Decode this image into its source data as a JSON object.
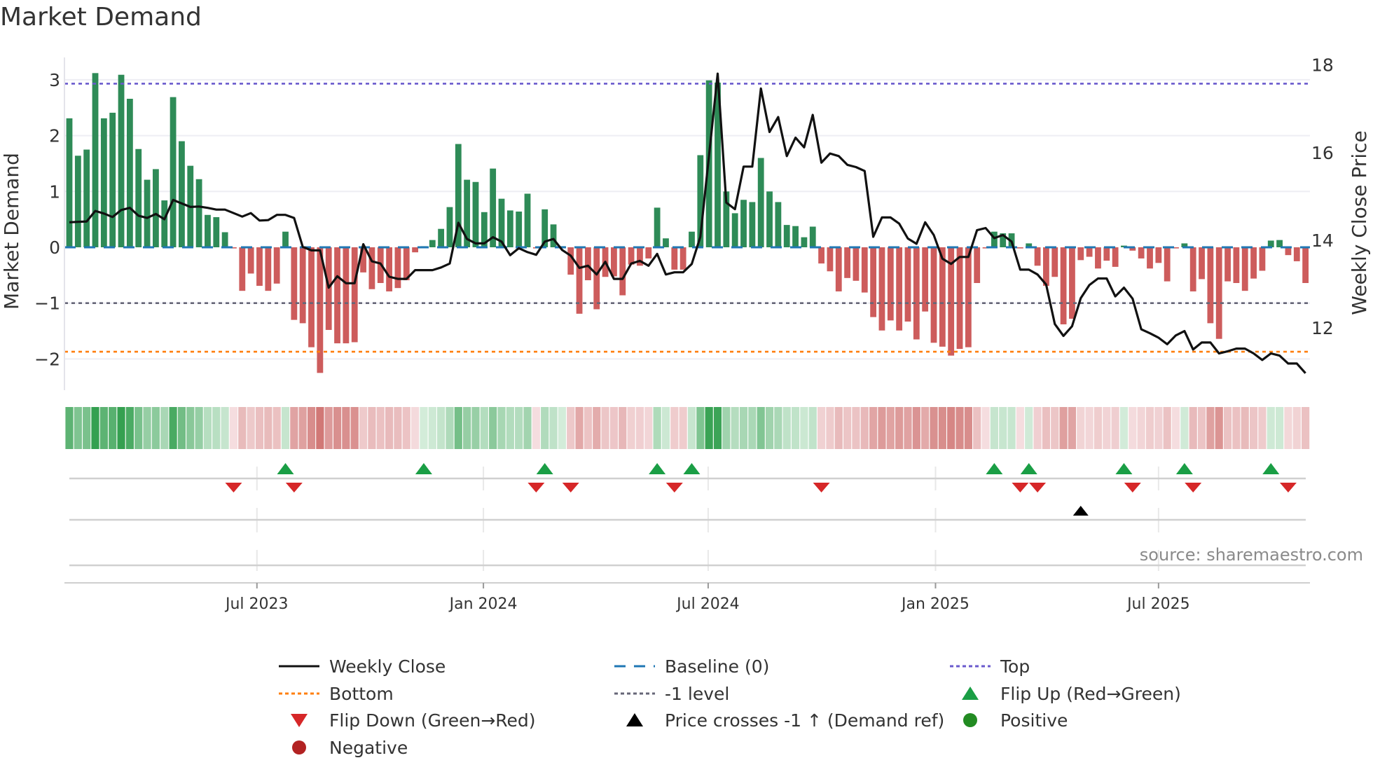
{
  "chart_data": {
    "type": "bar",
    "title": "Market Demand",
    "ylabel": "Market Demand",
    "y2label": "Weekly Close Price",
    "ylim": [
      -2.56,
      3.4
    ],
    "y2lim": [
      10.6,
      18.2
    ],
    "yticks": [
      {
        "v": 3,
        "label": "3"
      },
      {
        "v": 2,
        "label": "2"
      },
      {
        "v": 1,
        "label": "1"
      },
      {
        "v": 0,
        "label": "0"
      },
      {
        "v": -1,
        "label": "−1"
      },
      {
        "v": -2,
        "label": "−2"
      }
    ],
    "y2ticks": [
      {
        "v": 18,
        "label": "18"
      },
      {
        "v": 16,
        "label": "16"
      },
      {
        "v": 14,
        "label": "14"
      },
      {
        "v": 12,
        "label": "12"
      }
    ],
    "xticks": [
      {
        "week": 21.7,
        "label": "Jul 2023"
      },
      {
        "week": 47.9,
        "label": "Jan 2024"
      },
      {
        "week": 73.9,
        "label": "Jul 2024"
      },
      {
        "week": 100.2,
        "label": "Jan 2025"
      },
      {
        "week": 126.0,
        "label": "Jul 2025"
      }
    ],
    "levels": {
      "top": 2.93,
      "bottom": -1.87,
      "minus_one": -1,
      "baseline": 0
    },
    "demand": [
      2.31,
      1.64,
      1.75,
      3.12,
      2.31,
      2.41,
      3.09,
      2.66,
      1.76,
      1.21,
      1.4,
      0.84,
      2.69,
      1.9,
      1.46,
      1.22,
      0.58,
      0.54,
      0.27,
      -0.02,
      -0.78,
      -0.47,
      -0.69,
      -0.78,
      -0.65,
      0.28,
      -1.3,
      -1.36,
      -1.79,
      -2.25,
      -1.48,
      -1.72,
      -1.72,
      -1.7,
      -0.45,
      -0.75,
      -0.64,
      -0.79,
      -0.73,
      -0.59,
      -0.09,
      0.02,
      0.13,
      0.33,
      0.72,
      1.85,
      1.21,
      1.17,
      0.63,
      1.41,
      0.87,
      0.66,
      0.64,
      0.96,
      -0.02,
      0.68,
      0.41,
      0.02,
      -0.49,
      -1.19,
      -0.59,
      -1.11,
      -0.53,
      -0.52,
      -0.86,
      -0.31,
      -0.33,
      -0.2,
      0.71,
      0.16,
      -0.4,
      -0.4,
      0.28,
      1.65,
      2.99,
      2.95,
      1.0,
      0.61,
      0.85,
      0.81,
      1.6,
      1.0,
      0.81,
      0.4,
      0.38,
      0.18,
      0.37,
      -0.29,
      -0.43,
      -0.79,
      -0.55,
      -0.6,
      -0.81,
      -1.25,
      -1.49,
      -1.31,
      -1.49,
      -1.33,
      -1.65,
      -1.15,
      -1.71,
      -1.78,
      -1.94,
      -1.82,
      -1.79,
      -0.64,
      -0.02,
      0.28,
      0.25,
      0.25,
      -0.02,
      0.07,
      -0.33,
      -0.69,
      -0.53,
      -1.38,
      -1.28,
      -0.23,
      -0.17,
      -0.38,
      -0.24,
      -0.35,
      0.03,
      -0.06,
      -0.2,
      -0.38,
      -0.28,
      -0.61,
      -0.02,
      0.07,
      -0.79,
      -0.57,
      -1.36,
      -1.64,
      -0.61,
      -0.64,
      -0.78,
      -0.56,
      -0.42,
      0.12,
      0.13,
      -0.14,
      -0.25,
      -0.64
    ],
    "close": [
      14.41,
      14.42,
      14.43,
      14.67,
      14.61,
      14.53,
      14.69,
      14.74,
      14.56,
      14.51,
      14.6,
      14.48,
      14.92,
      14.84,
      14.76,
      14.77,
      14.74,
      14.7,
      14.7,
      14.62,
      14.54,
      14.62,
      14.45,
      14.46,
      14.58,
      14.58,
      14.51,
      13.85,
      13.77,
      13.77,
      12.92,
      13.18,
      13.02,
      13.02,
      13.91,
      13.52,
      13.47,
      13.17,
      13.12,
      13.12,
      13.32,
      13.32,
      13.32,
      13.38,
      13.47,
      14.4,
      14.03,
      13.93,
      13.93,
      14.07,
      13.97,
      13.66,
      13.82,
      13.73,
      13.67,
      13.97,
      14.03,
      13.78,
      13.65,
      13.37,
      13.42,
      13.22,
      13.51,
      13.12,
      13.12,
      13.47,
      13.53,
      13.42,
      13.69,
      13.22,
      13.27,
      13.27,
      13.46,
      14.08,
      15.94,
      17.8,
      14.86,
      14.71,
      15.68,
      15.68,
      17.46,
      16.47,
      16.81,
      15.92,
      16.34,
      16.12,
      16.86,
      15.77,
      15.98,
      15.92,
      15.72,
      15.67,
      15.58,
      14.08,
      14.52,
      14.52,
      14.38,
      14.04,
      13.92,
      14.41,
      14.12,
      13.58,
      13.46,
      13.62,
      13.62,
      14.23,
      14.28,
      14.05,
      14.12,
      13.97,
      13.33,
      13.33,
      13.22,
      12.99,
      12.09,
      11.82,
      12.04,
      12.68,
      12.98,
      13.13,
      13.13,
      12.72,
      12.92,
      12.67,
      11.97,
      11.88,
      11.78,
      11.63,
      11.83,
      11.93,
      11.51,
      11.67,
      11.67,
      11.42,
      11.47,
      11.53,
      11.53,
      11.42,
      11.27,
      11.42,
      11.37,
      11.19,
      11.19,
      10.97
    ],
    "flip_up": [
      25,
      41,
      55,
      68,
      72,
      107,
      111,
      122,
      129,
      139
    ],
    "flip_down": [
      19,
      26,
      54,
      58,
      70,
      87,
      110,
      112,
      123,
      130,
      141
    ],
    "price_cross_up": [
      117
    ],
    "legend_position": "bottom",
    "legend": {
      "weekly_close": "Weekly Close",
      "baseline": "Baseline (0)",
      "top": "Top",
      "bottom": "Bottom",
      "minus_one": "-1 level",
      "flip_up": "Flip Up (Red→Green)",
      "flip_down": "Flip Down (Green→Red)",
      "price_cross": "Price crosses -1 ↑ (Demand ref)",
      "positive": "Positive",
      "negative": "Negative"
    },
    "source": "source: sharemaestro.com",
    "colors": {
      "positive_bar": "#2e8b57",
      "negative_bar": "#cd5c5c",
      "close": "#111111",
      "baseline": "#1f77b4",
      "top": "#6a5acd",
      "bottom": "#ff7f0e",
      "minus_one": "#666677",
      "flip_up": "#1a9e45",
      "flip_down": "#d62728",
      "price_cross": "#000000",
      "positive_dot": "#228b22",
      "negative_dot": "#b22222"
    }
  }
}
